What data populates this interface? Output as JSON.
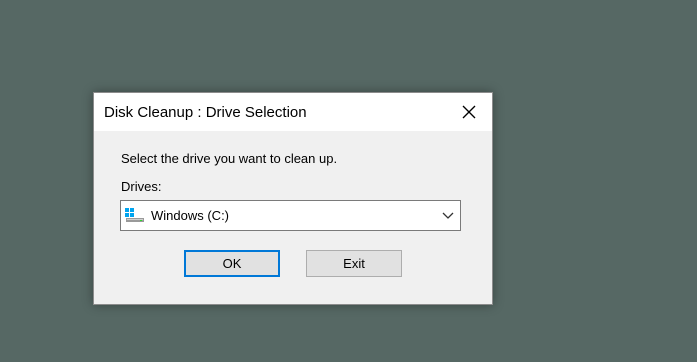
{
  "dialog": {
    "title": "Disk Cleanup : Drive Selection",
    "close_icon": "close-icon"
  },
  "content": {
    "prompt": "Select the drive you want to clean up.",
    "drives_label": "Drives:",
    "selected_drive": "Windows (C:)",
    "drive_icon": "hard-drive-icon",
    "dropdown_icon": "chevron-down-icon"
  },
  "buttons": {
    "ok_label": "OK",
    "exit_label": "Exit"
  },
  "colors": {
    "desktop_background": "#566864",
    "focus_border": "#0078d7"
  }
}
